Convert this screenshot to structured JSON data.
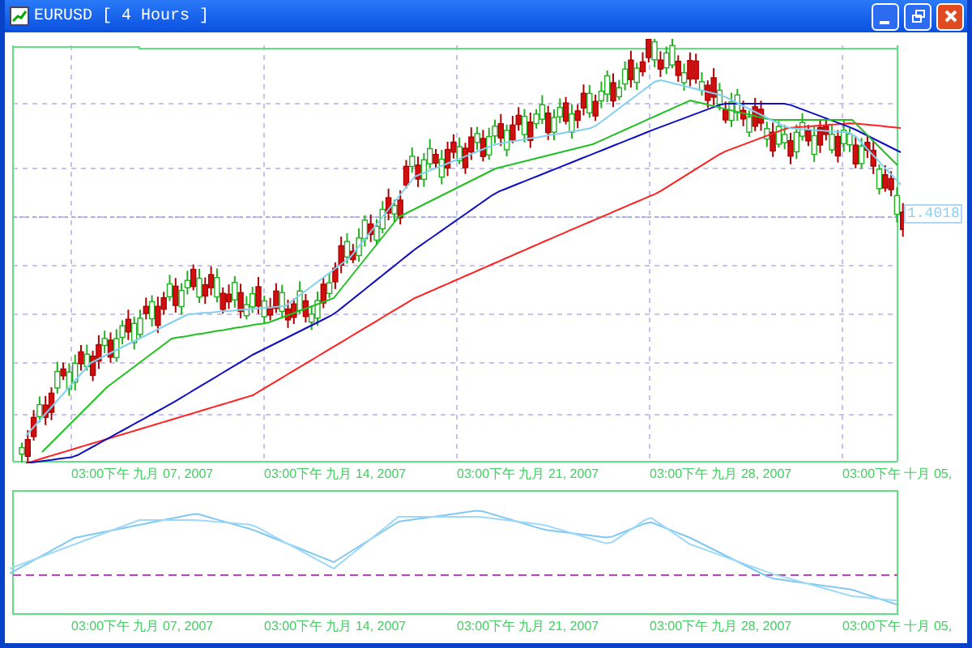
{
  "window": {
    "title": "EURUSD [ 4 Hours ]"
  },
  "price_chart": {
    "price_label": "1.4018",
    "time_axis": [
      "03:00下午 九月 07, 2007",
      "03:00下午 九月 14, 2007",
      "03:00下午 九月 21, 2007",
      "03:00下午 九月 28, 2007",
      "03:00下午 十月 05,"
    ]
  },
  "indicator_chart": {
    "time_axis": [
      "03:00下午 九月 07, 2007",
      "03:00下午 九月 14, 2007",
      "03:00下午 九月 21, 2007",
      "03:00下午 九月 28, 2007",
      "03:00下午 十月 05,"
    ]
  }
}
